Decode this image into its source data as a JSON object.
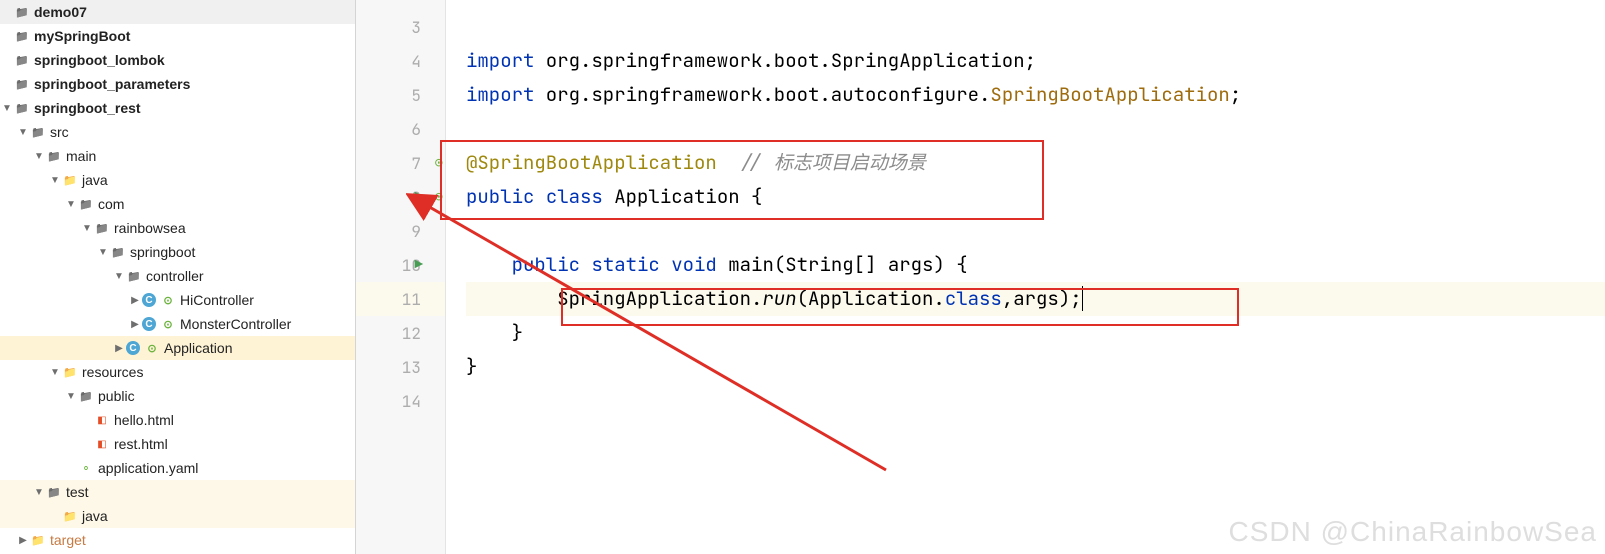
{
  "tree": [
    {
      "indent": 0,
      "arrow": "none",
      "icon": "folder-icon",
      "label": "demo07",
      "bold": true
    },
    {
      "indent": 0,
      "arrow": "none",
      "icon": "folder-icon",
      "label": "mySpringBoot",
      "bold": true
    },
    {
      "indent": 0,
      "arrow": "none",
      "icon": "folder-icon",
      "label": "springboot_lombok",
      "bold": true
    },
    {
      "indent": 0,
      "arrow": "none",
      "icon": "folder-icon",
      "label": "springboot_parameters",
      "bold": true
    },
    {
      "indent": 0,
      "arrow": "down",
      "icon": "folder-icon",
      "label": "springboot_rest",
      "bold": true
    },
    {
      "indent": 1,
      "arrow": "down",
      "icon": "folder-icon",
      "label": "src",
      "bold": false
    },
    {
      "indent": 2,
      "arrow": "down",
      "icon": "folder-icon",
      "label": "main",
      "bold": false
    },
    {
      "indent": 3,
      "arrow": "down",
      "icon": "folder-blue-icon",
      "label": "java",
      "bold": false
    },
    {
      "indent": 4,
      "arrow": "down",
      "icon": "folder-icon",
      "label": "com",
      "bold": false
    },
    {
      "indent": 5,
      "arrow": "down",
      "icon": "folder-icon",
      "label": "rainbowsea",
      "bold": false
    },
    {
      "indent": 6,
      "arrow": "down",
      "icon": "folder-icon",
      "label": "springboot",
      "bold": false
    },
    {
      "indent": 7,
      "arrow": "down",
      "icon": "folder-icon",
      "label": "controller",
      "bold": false
    },
    {
      "indent": 8,
      "arrow": "right",
      "icon": "class-icon",
      "spring": true,
      "label": "HiController",
      "bold": false
    },
    {
      "indent": 8,
      "arrow": "right",
      "icon": "class-icon",
      "spring": true,
      "label": "MonsterController",
      "bold": false
    },
    {
      "indent": 7,
      "arrow": "right",
      "icon": "class-icon",
      "spring": true,
      "label": "Application",
      "bold": false,
      "selected": true
    },
    {
      "indent": 3,
      "arrow": "down",
      "icon": "folder-orange-icon",
      "label": "resources",
      "bold": false
    },
    {
      "indent": 4,
      "arrow": "down",
      "icon": "folder-icon",
      "label": "public",
      "bold": false
    },
    {
      "indent": 5,
      "arrow": "none",
      "icon": "html-icon",
      "label": "hello.html",
      "bold": false
    },
    {
      "indent": 5,
      "arrow": "none",
      "icon": "html-icon",
      "label": "rest.html",
      "bold": false
    },
    {
      "indent": 4,
      "arrow": "none",
      "icon": "yaml-icon",
      "label": "application.yaml",
      "bold": false
    },
    {
      "indent": 2,
      "arrow": "down",
      "icon": "folder-icon",
      "label": "test",
      "bold": false,
      "hl": true
    },
    {
      "indent": 3,
      "arrow": "none",
      "icon": "folder-green-icon",
      "label": "java",
      "bold": false,
      "hl": true
    },
    {
      "indent": 1,
      "arrow": "right",
      "icon": "folder-orange-icon",
      "label": "target",
      "bold": false,
      "orange": true
    }
  ],
  "gutter": {
    "lines": [
      3,
      4,
      5,
      6,
      7,
      8,
      9,
      10,
      11,
      12,
      13,
      14
    ],
    "spring_lines": [
      7,
      8
    ],
    "run_lines": [
      8,
      10
    ],
    "hl_line": 11
  },
  "code": {
    "l3": "",
    "l4": {
      "kw": "import",
      "pkg": " org.springframework.boot.SpringApplication;"
    },
    "l5": {
      "kw": "import",
      "pkg": " org.springframework.boot.autoconfigure.",
      "cls": "SpringBootApplication",
      "end": ";"
    },
    "l6": "",
    "l7": {
      "anno": "@SpringBootApplication",
      "comment": "  // 标志项目启动场景"
    },
    "l8": {
      "kw1": "public",
      "kw2": "class",
      "name": " Application {"
    },
    "l9": "",
    "l10": {
      "kw1": "public",
      "kw2": "static",
      "kw3": "void",
      "name": " main(String[] args) {"
    },
    "l11": {
      "pre": "        SpringApplication.",
      "method": "run",
      "mid": "(Application.",
      "field": "class",
      "post": ",args);"
    },
    "l12": "    }",
    "l13": "}",
    "l14": ""
  },
  "watermark": "CSDN @ChinaRainbowSea"
}
